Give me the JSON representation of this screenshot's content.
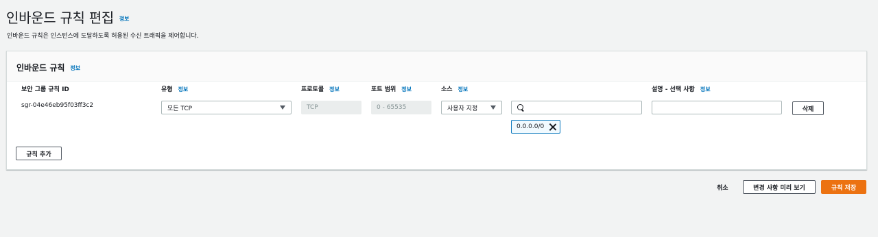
{
  "page": {
    "title": "인바운드 규칙 편집",
    "info": "정보",
    "description": "인바운드 규칙은 인스턴스에 도달하도록 허용된 수신 트래픽을 제어합니다."
  },
  "panel": {
    "title": "인바운드 규칙",
    "info": "정보",
    "columns": {
      "sg_rule_id": "보안 그룹 규칙 ID",
      "type": "유형",
      "protocol": "프로토콜",
      "port_range": "포트 범위",
      "source": "소스",
      "description": "설명 - 선택 사항",
      "info": "정보"
    },
    "rule": {
      "id": "sgr-04e46eb95f03ff3c2",
      "type": "모든 TCP",
      "protocol": "TCP",
      "port_range": "0 - 65535",
      "source_type": "사용자 지정",
      "search_value": "",
      "cidr": "0.0.0.0/0",
      "description_value": "",
      "delete_label": "삭제"
    },
    "add_rule_label": "규칙 추가"
  },
  "footer": {
    "cancel_label": "취소",
    "preview_label": "변경 사항 미리 보기",
    "save_label": "규칙 저장"
  },
  "colors": {
    "primary": "#ec7211",
    "link": "#0073bb",
    "token_border": "#0073bb"
  }
}
